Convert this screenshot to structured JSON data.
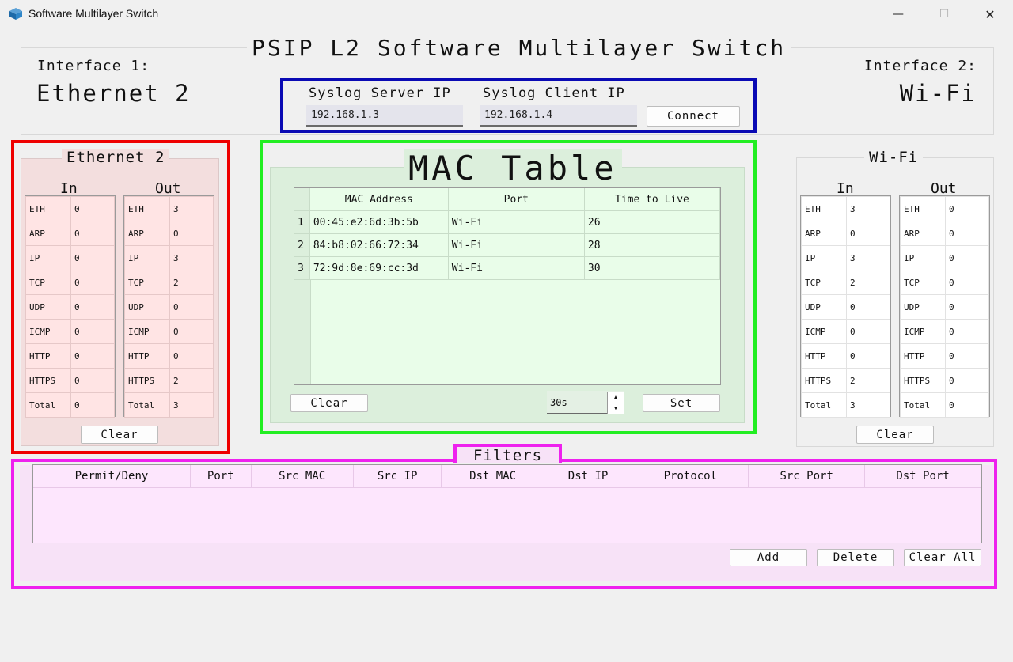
{
  "window": {
    "title": "Software Multilayer Switch",
    "minimize_glyph": "—",
    "maximize_glyph": "☐",
    "close_glyph": "✕"
  },
  "header": {
    "title": "PSIP L2 Software Multilayer Switch",
    "interface1_label": "Interface 1:",
    "interface1_value": "Ethernet 2",
    "interface2_label": "Interface 2:",
    "interface2_value": "Wi-Fi",
    "syslog": {
      "server_label": "Syslog Server IP",
      "server_value": "192.168.1.3",
      "client_label": "Syslog Client IP",
      "client_value": "192.168.1.4",
      "connect_label": "Connect"
    }
  },
  "left_panel": {
    "title": "Ethernet 2",
    "in_label": "In",
    "out_label": "Out",
    "in_rows": [
      [
        "ETH",
        "0"
      ],
      [
        "ARP",
        "0"
      ],
      [
        "IP",
        "0"
      ],
      [
        "TCP",
        "0"
      ],
      [
        "UDP",
        "0"
      ],
      [
        "ICMP",
        "0"
      ],
      [
        "HTTP",
        "0"
      ],
      [
        "HTTPS",
        "0"
      ],
      [
        "Total",
        "0"
      ]
    ],
    "out_rows": [
      [
        "ETH",
        "3"
      ],
      [
        "ARP",
        "0"
      ],
      [
        "IP",
        "3"
      ],
      [
        "TCP",
        "2"
      ],
      [
        "UDP",
        "0"
      ],
      [
        "ICMP",
        "0"
      ],
      [
        "HTTP",
        "0"
      ],
      [
        "HTTPS",
        "2"
      ],
      [
        "Total",
        "3"
      ]
    ],
    "clear_label": "Clear"
  },
  "right_panel": {
    "title": "Wi-Fi",
    "in_label": "In",
    "out_label": "Out",
    "in_rows": [
      [
        "ETH",
        "3"
      ],
      [
        "ARP",
        "0"
      ],
      [
        "IP",
        "3"
      ],
      [
        "TCP",
        "2"
      ],
      [
        "UDP",
        "0"
      ],
      [
        "ICMP",
        "0"
      ],
      [
        "HTTP",
        "0"
      ],
      [
        "HTTPS",
        "2"
      ],
      [
        "Total",
        "3"
      ]
    ],
    "out_rows": [
      [
        "ETH",
        "0"
      ],
      [
        "ARP",
        "0"
      ],
      [
        "IP",
        "0"
      ],
      [
        "TCP",
        "0"
      ],
      [
        "UDP",
        "0"
      ],
      [
        "ICMP",
        "0"
      ],
      [
        "HTTP",
        "0"
      ],
      [
        "HTTPS",
        "0"
      ],
      [
        "Total",
        "0"
      ]
    ],
    "clear_label": "Clear"
  },
  "mac_table": {
    "title": "MAC Table",
    "columns": [
      "MAC Address",
      "Port",
      "Time to Live"
    ],
    "rows": [
      [
        "1",
        "00:45:e2:6d:3b:5b",
        "Wi-Fi",
        "26"
      ],
      [
        "2",
        "84:b8:02:66:72:34",
        "Wi-Fi",
        "28"
      ],
      [
        "3",
        "72:9d:8e:69:cc:3d",
        "Wi-Fi",
        "30"
      ]
    ],
    "clear_label": "Clear",
    "ttl_value": "30s",
    "spin_up": "▲",
    "spin_down": "▼",
    "set_label": "Set"
  },
  "filters": {
    "title": "Filters",
    "columns": [
      "Permit/Deny",
      "Port",
      "Src MAC",
      "Src IP",
      "Dst MAC",
      "Dst IP",
      "Protocol",
      "Src Port",
      "Dst Port"
    ],
    "add_label": "Add",
    "delete_label": "Delete",
    "clear_all_label": "Clear All"
  },
  "colors": {
    "red_frame": "#ee0000",
    "green_frame": "#22ee22",
    "blue_frame": "#0a0ab4",
    "magenta_frame": "#ee22ee",
    "red_fill": "#f3dede",
    "green_fill": "#dcefdc",
    "magenta_fill": "#f7e2f7"
  }
}
